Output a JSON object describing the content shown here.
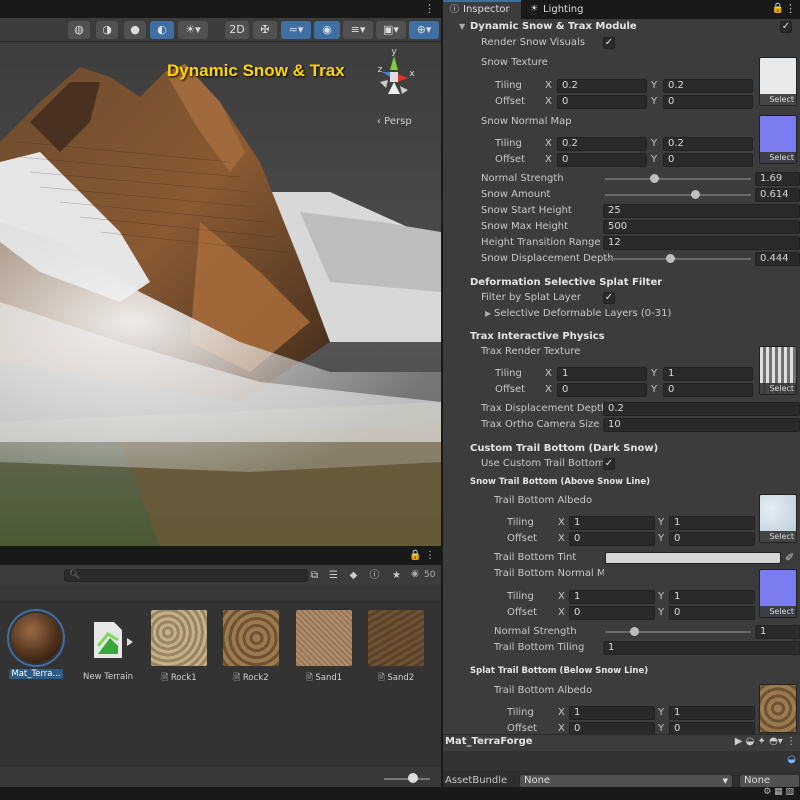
{
  "scene": {
    "title": "Dynamic Snow & Trax",
    "persp_label": "‹ Persp",
    "gizmo": {
      "x": "x",
      "y": "y",
      "z": "z"
    },
    "more_icon": "⋮",
    "toolbar_icons": [
      "◍",
      "◑",
      "●",
      "◐",
      "☀▾",
      "2D",
      "✠",
      "≈▾",
      "◉",
      "≡▾",
      "▣▾",
      "⊕▾"
    ]
  },
  "project": {
    "tab_icons": "🔒 ⋮",
    "search_placeholder": "",
    "toolbar_icons": [
      "⧉",
      "☰",
      "◆",
      "ⓘ",
      "★"
    ],
    "count": "50",
    "assets": [
      {
        "label": "Mat_Terra...",
        "kind": "material",
        "selected": true
      },
      {
        "label": "New Terrain",
        "kind": "terrain",
        "selected": false
      },
      {
        "label": "Rock1",
        "kind": "texture",
        "color": "#b39e78",
        "selected": false
      },
      {
        "label": "Rock2",
        "kind": "texture",
        "color": "#8a6b45",
        "selected": false
      },
      {
        "label": "Sand1",
        "kind": "texture",
        "color": "#a48565",
        "selected": false
      },
      {
        "label": "Sand2",
        "kind": "texture",
        "color": "#6b4f32",
        "selected": false
      }
    ]
  },
  "inspector": {
    "tabs": [
      {
        "label": "Inspector",
        "icon": "ⓘ",
        "active": true
      },
      {
        "label": "Lighting",
        "icon": "☀",
        "active": false
      }
    ],
    "lock_icon": "🔒",
    "more_icon": "⋮",
    "module": {
      "label": "Dynamic Snow & Trax Module",
      "enabled": true
    },
    "render_snow_visuals": {
      "label": "Render Snow Visuals",
      "value": true
    },
    "snow_texture": {
      "label": "Snow Texture",
      "tiling_label": "Tiling",
      "offset_label": "Offset",
      "tiling": {
        "x": "0.2",
        "y": "0.2"
      },
      "offset": {
        "x": "0",
        "y": "0"
      },
      "select": "Select"
    },
    "snow_normal_map": {
      "label": "Snow Normal Map",
      "tiling_label": "Tiling",
      "offset_label": "Offset",
      "tiling": {
        "x": "0.2",
        "y": "0.2"
      },
      "offset": {
        "x": "0",
        "y": "0"
      },
      "select": "Select"
    },
    "normal_strength": {
      "label": "Normal Strength",
      "value": "1.69",
      "fraction": 0.338
    },
    "snow_amount": {
      "label": "Snow Amount",
      "value": "0.614",
      "fraction": 0.614
    },
    "snow_start_height": {
      "label": "Snow Start Height",
      "value": "25"
    },
    "snow_max_height": {
      "label": "Snow Max Height",
      "value": "500"
    },
    "height_transition_range": {
      "label": "Height Transition Range",
      "value": "12"
    },
    "snow_displacement_depth": {
      "label": "Snow Displacement Depth",
      "value": "0.444",
      "fraction": 0.444
    },
    "deformation_header": "Deformation Selective Splat Filter",
    "filter_by_splat_layer": {
      "label": "Filter by Splat Layer",
      "value": true
    },
    "selective_layers": {
      "label": "Selective Deformable Layers (0-31)"
    },
    "trax_header": "Trax Interactive Physics",
    "trax_render_texture": {
      "label": "Trax Render Texture",
      "tiling_label": "Tiling",
      "offset_label": "Offset",
      "tiling": {
        "x": "1",
        "y": "1"
      },
      "offset": {
        "x": "0",
        "y": "0"
      },
      "select": "Select"
    },
    "trax_displacement_depth": {
      "label": "Trax Displacement Depth",
      "value": "0.2"
    },
    "trax_ortho_camera_size": {
      "label": "Trax Ortho Camera Size",
      "value": "10"
    },
    "custom_trail_header": "Custom Trail Bottom (Dark Snow)",
    "use_custom_trail_bottom": {
      "label": "Use Custom Trail Bottom",
      "value": true
    },
    "snow_trail_header": "Snow Trail Bottom (Above Snow Line)",
    "trail_bottom_albedo": {
      "label": "Trail Bottom Albedo",
      "tiling_label": "Tiling",
      "offset_label": "Offset",
      "tiling": {
        "x": "1",
        "y": "1"
      },
      "offset": {
        "x": "0",
        "y": "0"
      },
      "select": "Select"
    },
    "trail_bottom_tint": {
      "label": "Trail Bottom Tint",
      "color": "#d6d6d6"
    },
    "trail_bottom_normal_map": {
      "label": "Trail Bottom Normal Map",
      "tiling_label": "Tiling",
      "offset_label": "Offset",
      "tiling": {
        "x": "1",
        "y": "1"
      },
      "offset": {
        "x": "0",
        "y": "0"
      },
      "select": "Select"
    },
    "trail_normal_strength": {
      "label": "Normal Strength",
      "value": "1",
      "fraction": 0.2
    },
    "trail_bottom_tiling": {
      "label": "Trail Bottom Tiling",
      "value": "1"
    },
    "splat_trail_header": "Splat Trail Bottom (Below Snow Line)",
    "splat_trail_bottom_albedo": {
      "label": "Trail Bottom Albedo",
      "tiling_label": "Tiling",
      "offset_label": "Offset",
      "tiling": {
        "x": "1",
        "y": "1"
      },
      "offset": {
        "x": "0",
        "y": "0"
      }
    }
  },
  "footer": {
    "material_name": "Mat_TerraForge",
    "icons": "▶ ◒ ✦ ◓▾ ⋮",
    "assetbundle_label": "AssetBundle",
    "assetbundle_value": "None",
    "assetbundle_variant": "None"
  },
  "colors": {
    "accent": "#3e6fa0",
    "panel": "#3c3c3c",
    "field": "#2a2a2a",
    "title_yellow": "#ffd600"
  }
}
